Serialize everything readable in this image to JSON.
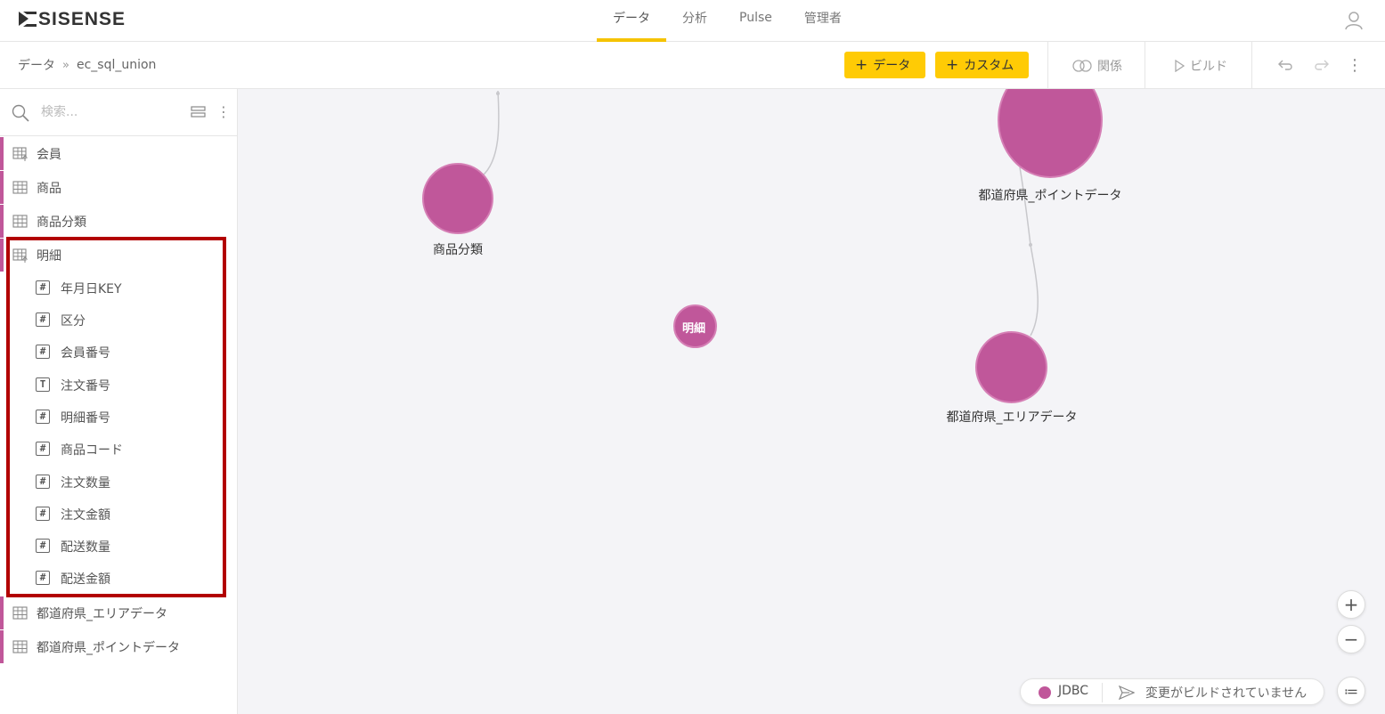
{
  "brand": {
    "name": "SISENSE",
    "accent": "#f5c300",
    "node_color": "#c0579a",
    "highlight_color": "#b20000"
  },
  "topnav": {
    "tabs": [
      {
        "label": "データ",
        "active": true
      },
      {
        "label": "分析",
        "active": false
      },
      {
        "label": "Pulse",
        "active": false
      },
      {
        "label": "管理者",
        "active": false
      }
    ],
    "user_icon": "user-icon"
  },
  "subheader": {
    "breadcrumb_root": "データ",
    "breadcrumb_sep": "»",
    "breadcrumb_current": "ec_sql_union",
    "add_data_label": "データ",
    "add_custom_label": "カスタム",
    "relations_label": "関係",
    "build_label": "ビルド"
  },
  "sidebar": {
    "search_placeholder": "検索...",
    "tables": [
      {
        "label": "会員",
        "icon": "custom-table-icon"
      },
      {
        "label": "商品",
        "icon": "table-icon"
      },
      {
        "label": "商品分類",
        "icon": "table-icon"
      },
      {
        "label": "明細",
        "icon": "custom-table-icon",
        "expanded": true
      },
      {
        "label": "都道府県_エリアデータ",
        "icon": "table-icon"
      },
      {
        "label": "都道府県_ポイントデータ",
        "icon": "table-icon"
      }
    ],
    "columns": [
      {
        "label": "年月日KEY",
        "type": "#"
      },
      {
        "label": "区分",
        "type": "#"
      },
      {
        "label": "会員番号",
        "type": "#"
      },
      {
        "label": "注文番号",
        "type": "T"
      },
      {
        "label": "明細番号",
        "type": "#"
      },
      {
        "label": "商品コード",
        "type": "#"
      },
      {
        "label": "注文数量",
        "type": "#"
      },
      {
        "label": "注文金額",
        "type": "#"
      },
      {
        "label": "配送数量",
        "type": "#"
      },
      {
        "label": "配送金額",
        "type": "#"
      }
    ]
  },
  "canvas": {
    "nodes": {
      "shohin_bunrui": "商品分類",
      "meisai": "明細",
      "point": "都道府県_ポイントデータ",
      "area": "都道府県_エリアデータ"
    },
    "zoom_in": "+",
    "zoom_out": "−",
    "list_toggle": "≔"
  },
  "status": {
    "source": "JDBC",
    "message": "変更がビルドされていません"
  }
}
